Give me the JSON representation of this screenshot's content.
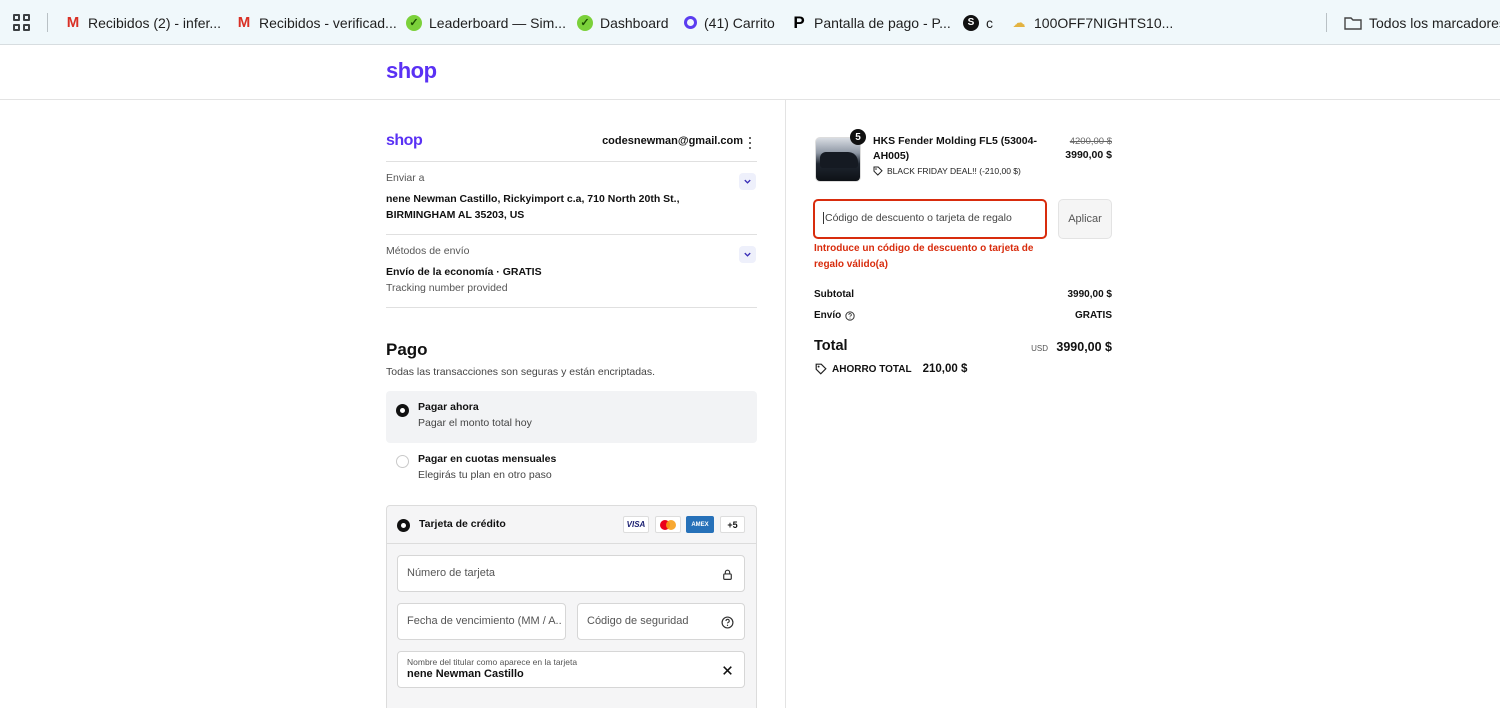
{
  "bookmarks": [
    {
      "label": "Recibidos (2) - infer...",
      "icon": "gmail-icon"
    },
    {
      "label": "Recibidos - verificad...",
      "icon": "gmail-icon"
    },
    {
      "label": "Leaderboard — Sim...",
      "icon": "leaf-icon"
    },
    {
      "label": "Dashboard",
      "icon": "leaf-icon"
    },
    {
      "label": "(41) Carrito",
      "icon": "ring-icon"
    },
    {
      "label": "Pantalla de pago - P...",
      "icon": "p-logo-icon"
    },
    {
      "label": "c",
      "icon": "s-circle-icon"
    },
    {
      "label": "100OFF7NIGHTS10...",
      "icon": "cloud-icon"
    }
  ],
  "all_bookmarks": "Todos los marcadores",
  "brand": "shop",
  "account": {
    "email": "codesnewman@gmail.com"
  },
  "shipping": {
    "label": "Enviar a",
    "address_line1": "nene Newman Castillo, Rickyimport c.a, 710 North 20th St.,",
    "address_line2": "BIRMINGHAM AL 35203, US"
  },
  "shipping_method": {
    "label": "Métodos de envío",
    "value": "Envío de la economía · GRATIS",
    "sub": "Tracking number provided"
  },
  "payment": {
    "title": "Pago",
    "subtitle": "Todas las transacciones son seguras y están encriptadas.",
    "options": [
      {
        "title": "Pagar ahora",
        "sub": "Pagar el monto total hoy",
        "selected": true
      },
      {
        "title": "Pagar en cuotas mensuales",
        "sub": "Elegirás tu plan en otro paso",
        "selected": false
      }
    ],
    "method_label": "Tarjeta de crédito",
    "card_brands": [
      "VISA",
      "mastercard",
      "AMEX",
      "+5"
    ],
    "card_number_placeholder": "Número de tarjeta",
    "expiry_placeholder": "Fecha de vencimiento (MM / A...",
    "cvv_placeholder": "Código de seguridad",
    "holder_label": "Nombre del titular como aparece en la tarjeta",
    "holder_value": "nene Newman Castillo"
  },
  "order": {
    "quantity": "5",
    "product_name": "HKS Fender Molding FL5 (53004-AH005)",
    "discount_tag": "BLACK FRIDAY DEAL!! (-210,00 $)",
    "price_original": "4200,00 $",
    "price_current": "3990,00 $",
    "discount_placeholder": "Código de descuento o tarjeta de regalo",
    "apply_label": "Aplicar",
    "error": "Introduce un código de descuento o tarjeta de regalo válido(a)",
    "subtotal_label": "Subtotal",
    "subtotal_value": "3990,00 $",
    "shipping_label": "Envío",
    "shipping_value": "GRATIS",
    "total_label": "Total",
    "currency": "USD",
    "total_value": "3990,00 $",
    "savings_label": "AHORRO TOTAL",
    "savings_value": "210,00 $"
  },
  "colors": {
    "brand": "#5a31f4",
    "error": "#d82c0d",
    "text": "#111111"
  }
}
